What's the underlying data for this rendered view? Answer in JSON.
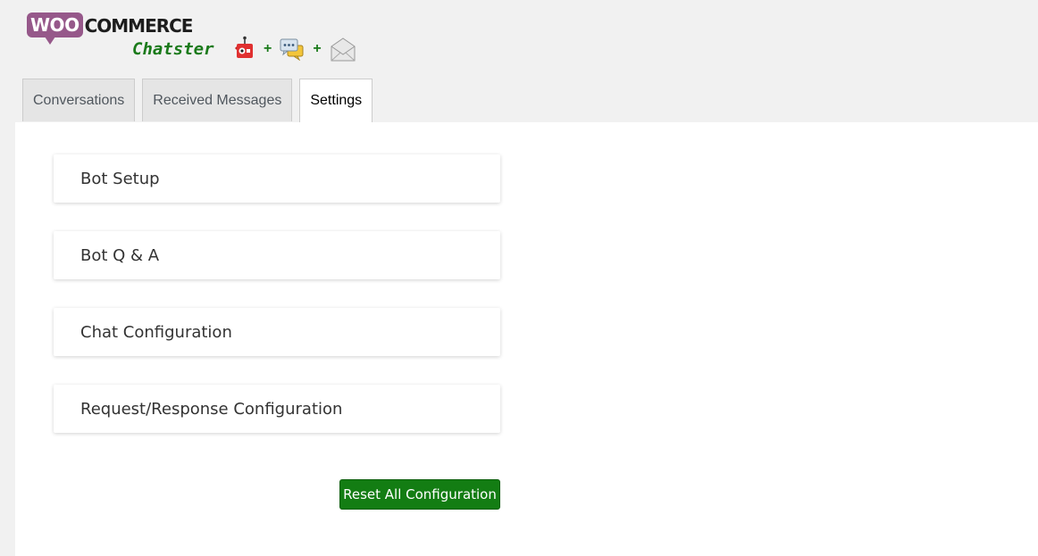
{
  "header": {
    "logo_woo": "WOO",
    "logo_commerce": "COMMERCE",
    "subtitle": "Chatster",
    "plus_1": "+",
    "plus_2": "+",
    "icons": [
      "robot-icon",
      "chat-bubbles-icon",
      "envelope-icon"
    ]
  },
  "tabs": [
    {
      "label": "Conversations",
      "active": false
    },
    {
      "label": "Received Messages",
      "active": false
    },
    {
      "label": "Settings",
      "active": true
    }
  ],
  "sections": [
    {
      "label": "Bot Setup"
    },
    {
      "label": "Bot Q & A"
    },
    {
      "label": "Chat Configuration"
    },
    {
      "label": "Request/Response Configuration"
    }
  ],
  "reset_button": {
    "label": "Reset All Configuration"
  },
  "colors": {
    "woo_purple": "#96588a",
    "brand_green": "#1a7a1a",
    "button_green": "#137d13",
    "panel_bg": "#ffffff",
    "page_bg": "#f1f1f1"
  }
}
